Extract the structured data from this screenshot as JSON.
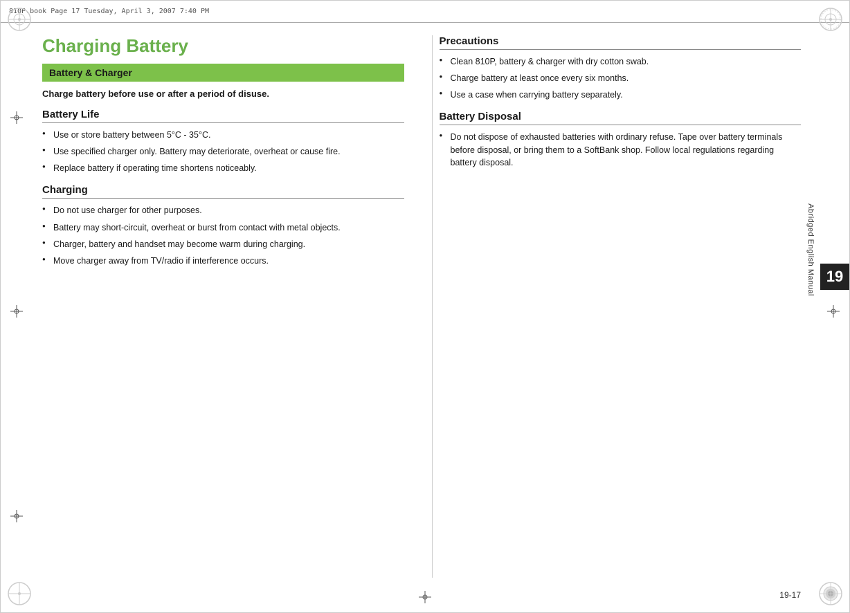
{
  "page": {
    "topbar_text": "810P.book  Page 17  Tuesday, April 3, 2007  7:40 PM",
    "page_number": "19",
    "page_number_bottom": "19-17",
    "side_label": "Abridged English Manual"
  },
  "main_title": "Charging Battery",
  "left_column": {
    "banner_label": "Battery & Charger",
    "intro_text": "Charge battery before use or after a period of disuse.",
    "battery_life": {
      "header": "Battery Life",
      "items": [
        "Use or store battery between 5°C - 35°C.",
        "Use specified charger only. Battery may deteriorate, overheat or cause fire.",
        "Replace battery if operating time shortens noticeably."
      ]
    },
    "charging": {
      "header": "Charging",
      "items": [
        "Do not use charger for other purposes.",
        "Battery may short-circuit, overheat or burst from contact with metal objects.",
        "Charger, battery and handset may become warm during charging.",
        "Move charger away from TV/radio if interference occurs."
      ]
    }
  },
  "right_column": {
    "precautions": {
      "header": "Precautions",
      "items": [
        "Clean 810P, battery & charger with dry cotton swab.",
        "Charge battery at least once every six months.",
        "Use a case when carrying battery separately."
      ]
    },
    "battery_disposal": {
      "header": "Battery Disposal",
      "items": [
        "Do not dispose of exhausted batteries with ordinary refuse. Tape over battery terminals before disposal, or bring them to a SoftBank shop. Follow local regulations regarding battery disposal."
      ]
    }
  }
}
